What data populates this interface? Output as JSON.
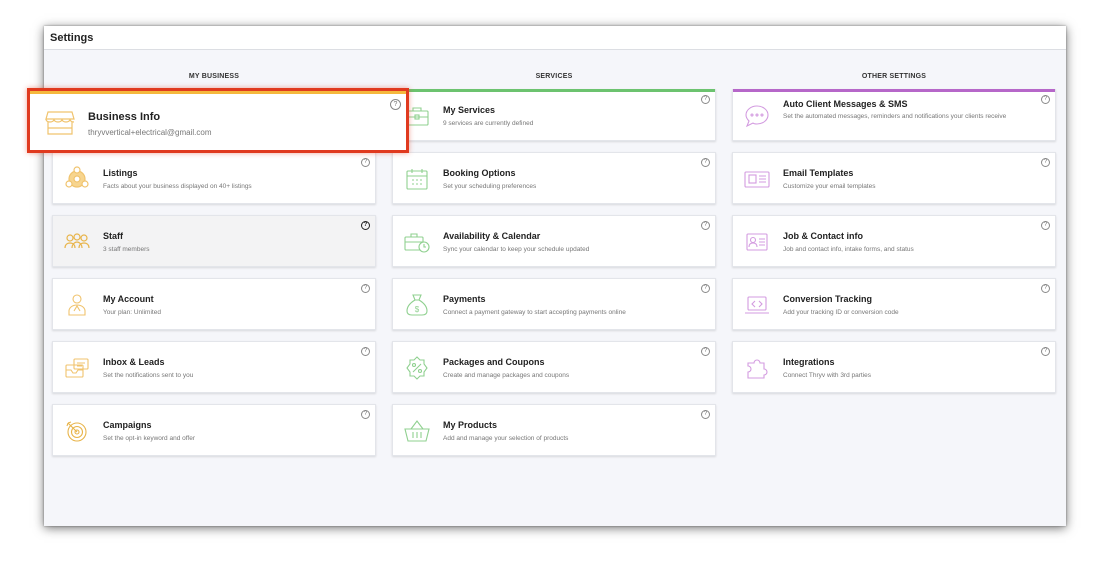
{
  "window": {
    "title": "Settings"
  },
  "columns": {
    "my_business": "MY BUSINESS",
    "services": "SERVICES",
    "other": "OTHER SETTINGS"
  },
  "colors": {
    "my_business_accent": "#f5b83d",
    "services_accent": "#6cc36f",
    "other_accent": "#b667c9",
    "highlight_border": "#e03a1f"
  },
  "my_business": [
    {
      "title": "Business Info",
      "desc": "thryvvertical+electrical@gmail.com",
      "icon": "storefront-icon"
    },
    {
      "title": "Listings",
      "desc": "Facts about your business displayed on 40+ listings",
      "icon": "listings-icon"
    },
    {
      "title": "Staff",
      "desc": "3 staff members",
      "icon": "staff-icon"
    },
    {
      "title": "My Account",
      "desc": "Your plan: Unlimited",
      "icon": "account-icon"
    },
    {
      "title": "Inbox & Leads",
      "desc": "Set the notifications sent to you",
      "icon": "inbox-icon"
    },
    {
      "title": "Campaigns",
      "desc": "Set the opt-in keyword and offer",
      "icon": "target-icon"
    }
  ],
  "services": [
    {
      "title": "My Services",
      "desc": "9 services are currently defined",
      "icon": "briefcase-icon"
    },
    {
      "title": "Booking Options",
      "desc": "Set your scheduling preferences",
      "icon": "calendar-icon"
    },
    {
      "title": "Availability & Calendar",
      "desc": "Sync your calendar to keep your schedule updated",
      "icon": "briefcase-clock-icon"
    },
    {
      "title": "Payments",
      "desc": "Connect a payment gateway to start accepting payments online",
      "icon": "money-bag-icon"
    },
    {
      "title": "Packages and Coupons",
      "desc": "Create and manage packages and coupons",
      "icon": "coupon-icon"
    },
    {
      "title": "My Products",
      "desc": "Add and manage your selection of products",
      "icon": "basket-icon"
    }
  ],
  "other": [
    {
      "title": "Auto Client Messages & SMS",
      "desc": "Set the automated messages, reminders and notifications your clients receive",
      "icon": "chat-bubble-icon"
    },
    {
      "title": "Email Templates",
      "desc": "Customize your email templates",
      "icon": "newsletter-icon"
    },
    {
      "title": "Job & Contact info",
      "desc": "Job and contact info, intake forms, and status",
      "icon": "contact-card-icon"
    },
    {
      "title": "Conversion Tracking",
      "desc": "Add your tracking ID or conversion code",
      "icon": "code-laptop-icon"
    },
    {
      "title": "Integrations",
      "desc": "Connect Thryv with 3rd parties",
      "icon": "puzzle-icon"
    }
  ],
  "help_glyph": "?"
}
